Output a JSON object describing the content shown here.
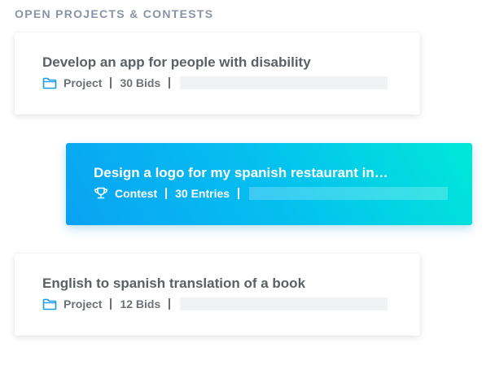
{
  "section": {
    "title": "OPEN PROJECTS & CONTESTS"
  },
  "items": [
    {
      "title": "Develop an app for people with disability",
      "type_label": "Project",
      "type_icon": "folder-icon",
      "count_label": "30 Bids",
      "highlighted": false
    },
    {
      "title": "Design a logo for my spanish restaurant in…",
      "type_label": "Contest",
      "type_icon": "trophy-icon",
      "count_label": "30 Entries",
      "highlighted": true
    },
    {
      "title": "English to spanish translation of a book",
      "type_label": "Project",
      "type_icon": "folder-icon",
      "count_label": "12 Bids",
      "highlighted": false
    }
  ],
  "colors": {
    "accent_blue": "#1a9be6",
    "gradient_start": "#0aa2f3",
    "gradient_end": "#00e8d8",
    "title_text": "#5b5f66",
    "section_title": "#8a93a6"
  }
}
